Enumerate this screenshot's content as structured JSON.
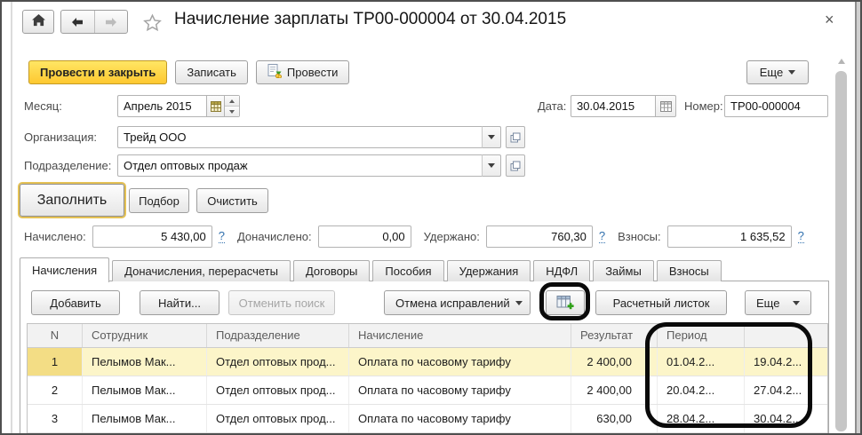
{
  "window": {
    "title": "Начисление зарплаты ТР00-000004 от 30.04.2015",
    "close": "×"
  },
  "toolbar": {
    "post_and_close": "Провести и закрыть",
    "save": "Записать",
    "post": "Провести",
    "more": "Еще"
  },
  "fields": {
    "month_label": "Месяц:",
    "month_value": "Апрель 2015",
    "date_label": "Дата:",
    "date_value": "30.04.2015",
    "number_label": "Номер:",
    "number_value": "ТР00-000004",
    "org_label": "Организация:",
    "org_value": "Трейд ООО",
    "dept_label": "Подразделение:",
    "dept_value": "Отдел оптовых продаж"
  },
  "fill_actions": {
    "fill": "Заполнить",
    "pick": "Подбор",
    "clear": "Очистить"
  },
  "totals": [
    {
      "label": "Начислено:",
      "value": "5 430,00",
      "help": "?"
    },
    {
      "label": "Доначислено:",
      "value": "0,00",
      "help": ""
    },
    {
      "label": "Удержано:",
      "value": "760,30",
      "help": "?"
    },
    {
      "label": "Взносы:",
      "value": "1 635,52",
      "help": "?"
    }
  ],
  "tabs": [
    {
      "label": "Начисления",
      "active": true
    },
    {
      "label": "Доначисления, перерасчеты",
      "active": false
    },
    {
      "label": "Договоры",
      "active": false
    },
    {
      "label": "Пособия",
      "active": false
    },
    {
      "label": "Удержания",
      "active": false
    },
    {
      "label": "НДФЛ",
      "active": false
    },
    {
      "label": "Займы",
      "active": false
    },
    {
      "label": "Взносы",
      "active": false
    }
  ],
  "grid_toolbar": {
    "add": "Добавить",
    "find": "Найти...",
    "cancel_search": "Отменить поиск",
    "undo_corrections": "Отмена исправлений",
    "payslip": "Расчетный листок",
    "more": "Еще"
  },
  "table": {
    "columns": [
      "N",
      "Сотрудник",
      "Подразделение",
      "Начисление",
      "Результат",
      "Период",
      ""
    ],
    "rows": [
      {
        "n": "1",
        "employee": "Пелымов Мак...",
        "department": "Отдел оптовых прод...",
        "accrual": "Оплата по часовому тарифу",
        "result": "2 400,00",
        "period_from": "01.04.2...",
        "period_to": "19.04.2...",
        "selected": true
      },
      {
        "n": "2",
        "employee": "Пелымов Мак...",
        "department": "Отдел оптовых прод...",
        "accrual": "Оплата по часовому тарифу",
        "result": "2 400,00",
        "period_from": "20.04.2...",
        "period_to": "27.04.2...",
        "selected": false
      },
      {
        "n": "3",
        "employee": "Пелымов Мак...",
        "department": "Отдел оптовых прод...",
        "accrual": "Оплата по часовому тарифу",
        "result": "630,00",
        "period_from": "28.04.2...",
        "period_to": "30.04.2...",
        "selected": false
      }
    ]
  },
  "icons": {
    "home": "house",
    "back": "arrow-left",
    "forward": "arrow-right",
    "favorite": "star-outline",
    "post": "document-with-coins",
    "month_picker": "grid-table",
    "date_picker": "calendar",
    "open_value": "overlapping-squares",
    "add_column": "table-with-green-plus"
  },
  "colors": {
    "primary_button": "#fec830",
    "fill_button_outline": "#e5c255",
    "selected_row": "#fcf5c9",
    "selected_row_number": "#f3dd85",
    "help_link": "#2f6fad",
    "annotation": "#0a0a0a"
  }
}
